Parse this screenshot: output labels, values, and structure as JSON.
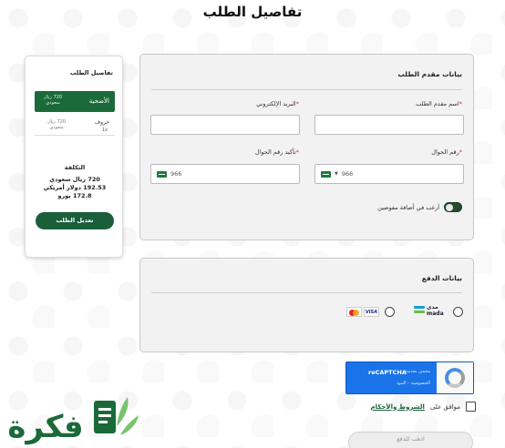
{
  "page": {
    "title": "تفاصيل الطلب"
  },
  "summary": {
    "title": "تفاصيل الطلب",
    "main_item": {
      "name": "الأضحية",
      "price_line1": "720 ريال",
      "price_line2": "سعودي"
    },
    "sub_item": {
      "name": "خروف",
      "qty": "1x",
      "price_line1": "720 ريال",
      "price_line2": "سعودي"
    },
    "cost_label": "التكلفة",
    "cost_lines": [
      "720 ريال سعودي",
      "192.53 دولار أمريكي",
      "172.8 يورو"
    ],
    "edit_button": "تعديل الطلب"
  },
  "applicant": {
    "title": "بيانات مقدم الطلب",
    "name_label": "اسم مقدم الطلب",
    "email_label": "البريد الإلكتروني",
    "phone_label": "رقم الجوال",
    "confirm_phone_label": "تأكيد رقم الجوال",
    "phone_code": "966",
    "confirm_phone_code": "966",
    "toggle_label": "أرغب في أضافة مفوضين"
  },
  "payment": {
    "title": "بيانات الدفع",
    "mada_ar": "مدى",
    "mada_en": "mada",
    "visa": "VISA"
  },
  "recaptcha": {
    "brand": "reCAPTCHA",
    "protected_by": "محمي بخدمة",
    "privacy_terms": "الخصوصية - البنود"
  },
  "agreement": {
    "prefix": "موافق على",
    "link": "الشروط والأحكام"
  },
  "pay_button": "اذهب للدفع",
  "logo": {
    "text": "فكرة"
  },
  "colors": {
    "brand_green": "#1b5e3a",
    "panel_bg": "#f2f2f2",
    "recaptcha_blue": "#1a73e8",
    "mada_blue": "#1a9bd7",
    "mada_green": "#6cbf43"
  }
}
